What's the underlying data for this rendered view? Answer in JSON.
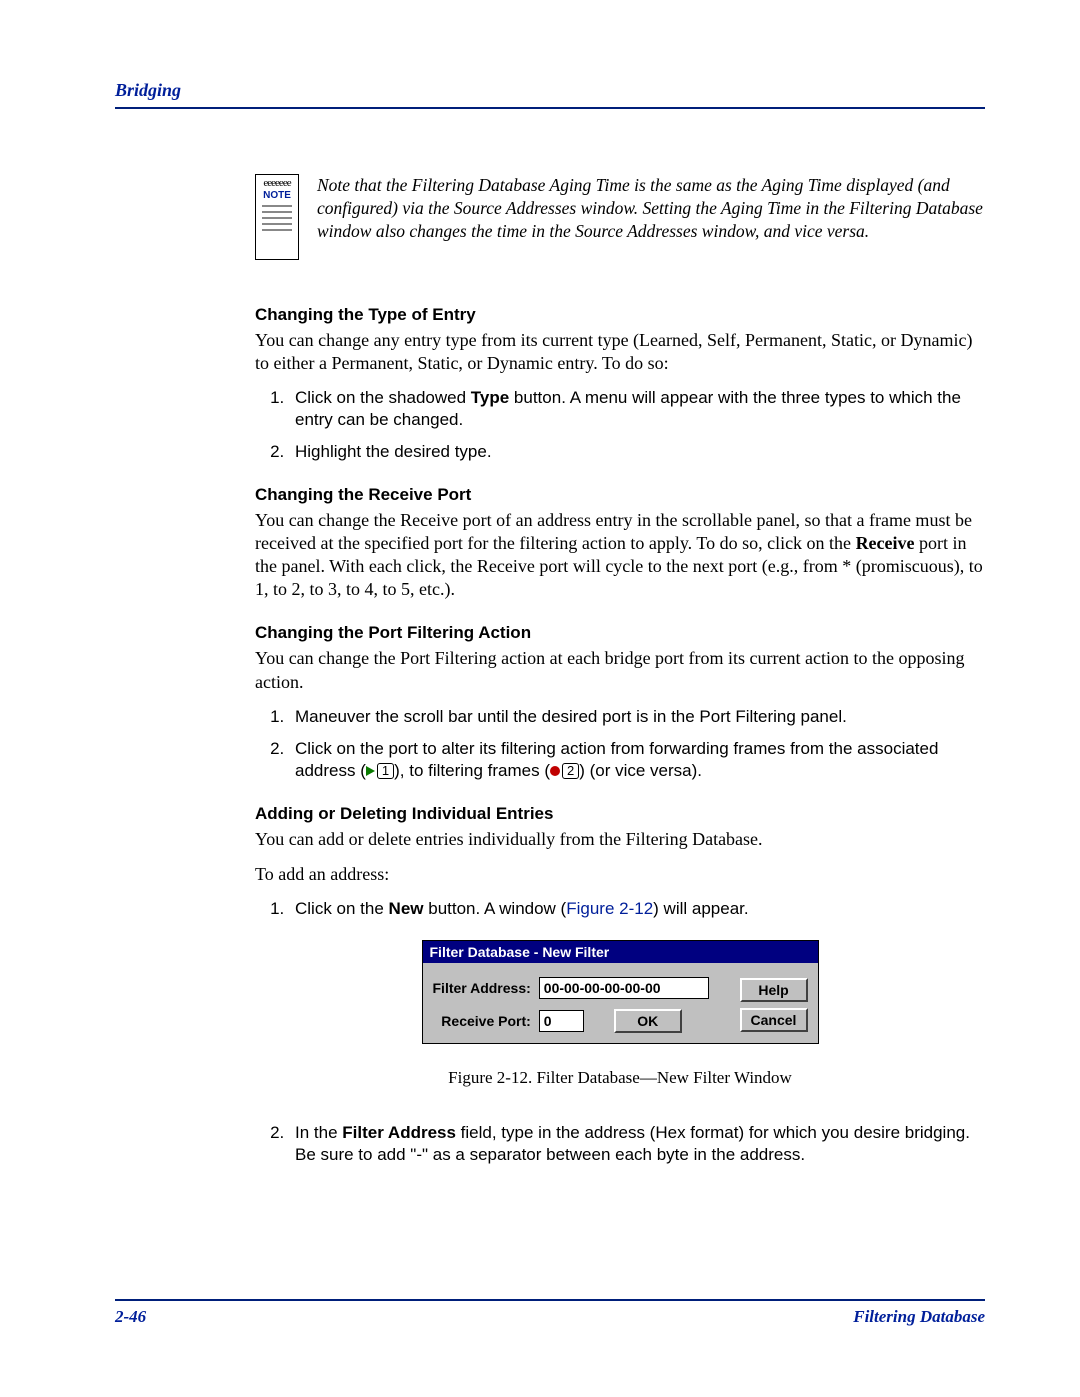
{
  "header": {
    "section": "Bridging"
  },
  "note": {
    "label": "NOTE",
    "text": "Note that the Filtering Database Aging Time is the same as the Aging Time displayed (and configured) via the Source Addresses window. Setting the Aging Time in the Filtering Database window also changes the time in the Source Addresses window, and vice versa."
  },
  "sec1": {
    "title": "Changing the Type of Entry",
    "para": "You can change any entry type from its current type (Learned, Self, Permanent, Static, or Dynamic) to either a Permanent, Static, or Dynamic entry. To do so:",
    "step1a": "Click on the shadowed ",
    "step1bold": "Type",
    "step1b": " button. A menu will appear with the three types to which the entry can be changed.",
    "step2": "Highlight the desired type."
  },
  "sec2": {
    "title": "Changing the Receive Port",
    "para_a": "You can change the Receive port of an address entry in the scrollable panel, so that a frame must be received at the specified port for the filtering action to apply. To do so, click on the ",
    "para_bold": "Receive",
    "para_b": " port in the panel. With each click, the Receive port will cycle to the next port (e.g., from * (promiscuous), to 1, to 2, to 3, to 4, to 5, etc.)."
  },
  "sec3": {
    "title": "Changing the Port Filtering Action",
    "para": "You can change the Port Filtering action at each bridge port from its current action to the opposing action.",
    "step1": "Maneuver the scroll bar until the desired port is in the Port Filtering panel.",
    "step2a": "Click on the port to alter its filtering action from forwarding frames from the associated address (",
    "step2mid": "), to filtering frames (",
    "step2b": ") (or vice versa).",
    "icon1_num": "1",
    "icon2_num": "2"
  },
  "sec4": {
    "title": "Adding or Deleting Individual Entries",
    "para": "You can add or delete entries individually from the Filtering Database.",
    "para2": "To add an address:",
    "step1a": "Click on the ",
    "step1bold": "New",
    "step1b": " button. A window (",
    "step1figref": "Figure 2-12",
    "step1c": ") will appear.",
    "step2a": "In the ",
    "step2bold": "Filter Address",
    "step2b": " field, type in the address (Hex format) for which you desire bridging. Be sure to add \"-\" as a separator between each byte in the address."
  },
  "nf_window": {
    "title": "Filter Database - New Filter",
    "filter_addr_label": "Filter Address:",
    "filter_addr_value": "00-00-00-00-00-00",
    "receive_port_label": "Receive Port:",
    "receive_port_value": "0",
    "ok": "OK",
    "help": "Help",
    "cancel": "Cancel"
  },
  "fig_caption": "Figure 2-12. Filter Database—New Filter Window",
  "footer": {
    "page": "2-46",
    "topic": "Filtering Database"
  }
}
